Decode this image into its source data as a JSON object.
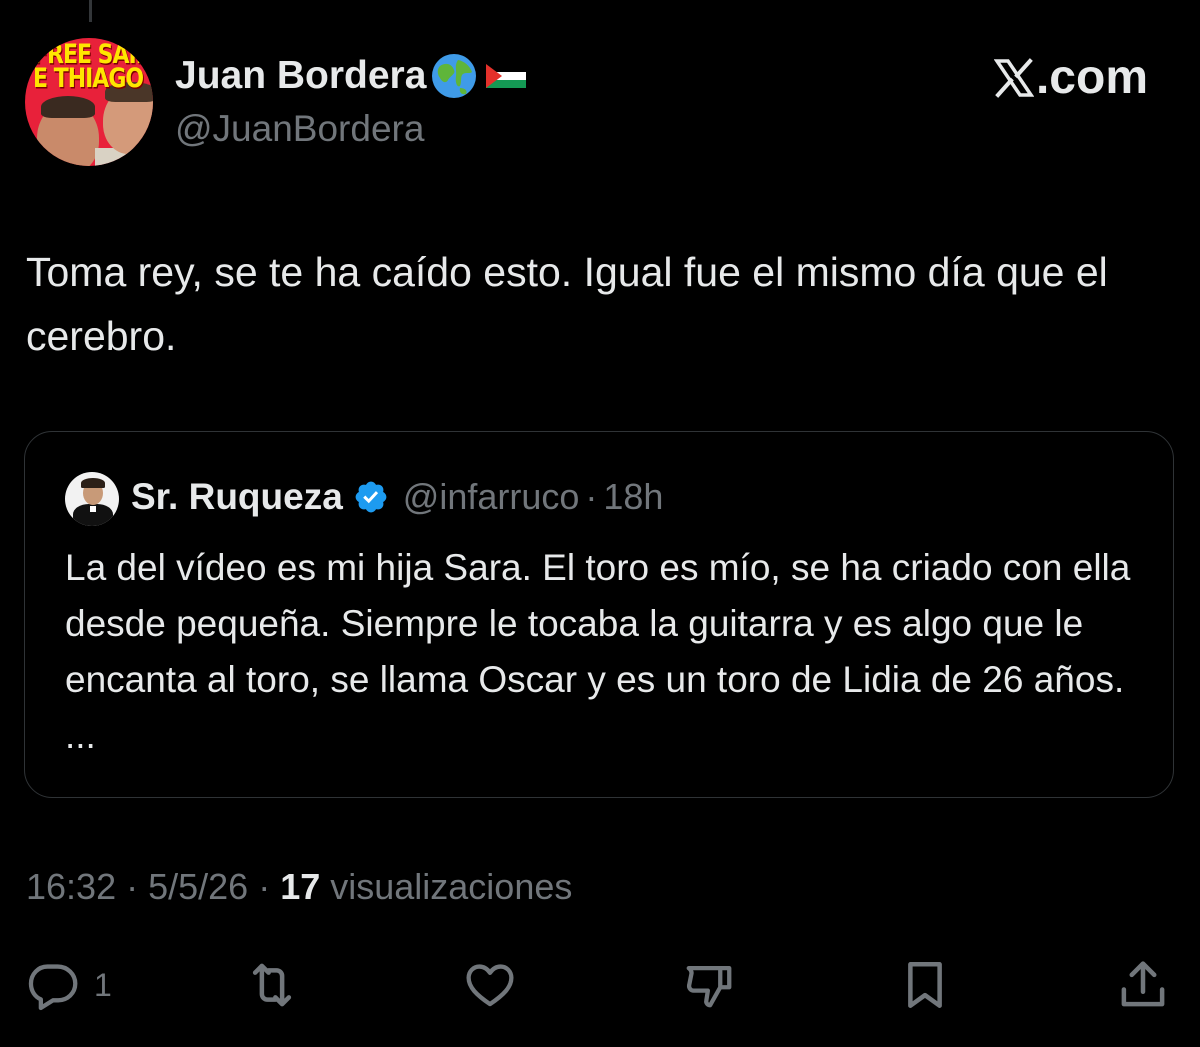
{
  "author": {
    "display_name": "Juan Bordera",
    "handle": "@JuanBordera",
    "avatar_text": "FREE SAIF E THIAGO",
    "emoji": [
      "globe-emoji",
      "palestine-flag-emoji"
    ]
  },
  "brand": {
    "site_label": ".com"
  },
  "tweet": {
    "text": "Toma rey, se te ha caído esto. Igual fue el mismo día que el cerebro."
  },
  "quoted": {
    "display_name": "Sr. Ruqueza",
    "handle": "@infarruco",
    "separator": "·",
    "time": "18h",
    "text": "La del vídeo es mi hija Sara. El toro es mío, se ha criado con ella desde pequeña. Siempre le tocaba la guitarra y es algo que le encanta al toro, se llama Oscar y es un toro de Lidia de 26 años. ..."
  },
  "meta": {
    "time": "16:32",
    "sep1": " · ",
    "date": "5/5/26",
    "sep2": " · ",
    "views_count": "17",
    "views_label": " visualizaciones"
  },
  "actions": {
    "reply_count": "1",
    "icons": [
      "reply-icon",
      "retweet-icon",
      "like-icon",
      "dislike-icon",
      "bookmark-icon",
      "share-icon"
    ]
  },
  "colors": {
    "background": "#000000",
    "text": "#e7e9ea",
    "muted": "#71767b",
    "border": "#2f3336",
    "verified": "#1d9bf0"
  }
}
